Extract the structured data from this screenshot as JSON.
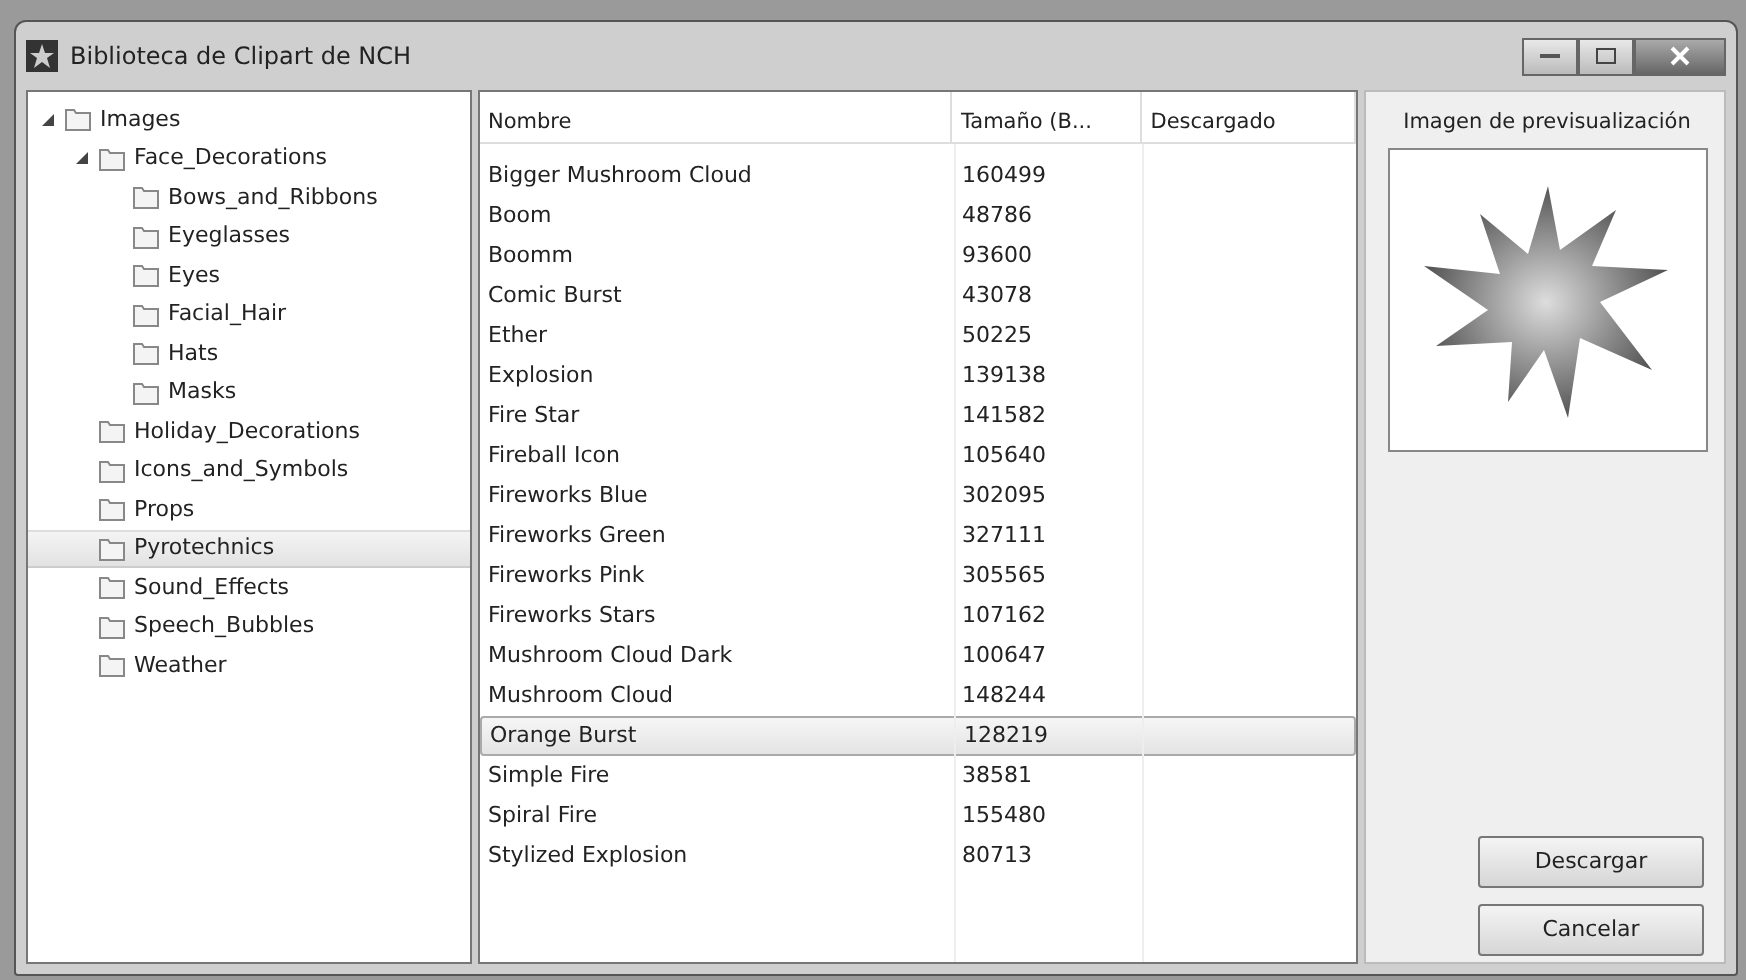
{
  "window": {
    "title": "Biblioteca de Clipart de NCH"
  },
  "tree": [
    {
      "label": "Images",
      "expanded": true,
      "selected": false,
      "children": [
        {
          "label": "Face_Decorations",
          "expanded": true,
          "selected": false,
          "children": [
            {
              "label": "Bows_and_Ribbons",
              "selected": false
            },
            {
              "label": "Eyeglasses",
              "selected": false
            },
            {
              "label": "Eyes",
              "selected": false
            },
            {
              "label": "Facial_Hair",
              "selected": false
            },
            {
              "label": "Hats",
              "selected": false
            },
            {
              "label": "Masks",
              "selected": false
            }
          ]
        },
        {
          "label": "Holiday_Decorations",
          "selected": false
        },
        {
          "label": "Icons_and_Symbols",
          "selected": false
        },
        {
          "label": "Props",
          "selected": false
        },
        {
          "label": "Pyrotechnics",
          "selected": true
        },
        {
          "label": "Sound_Effects",
          "selected": false
        },
        {
          "label": "Speech_Bubbles",
          "selected": false
        },
        {
          "label": "Weather",
          "selected": false
        }
      ]
    }
  ],
  "table": {
    "columns": [
      "Nombre",
      "Tamaño (B...",
      "Descargado"
    ],
    "rows": [
      {
        "name": "Bigger Mushroom Cloud",
        "size": "160499",
        "selected": false
      },
      {
        "name": "Boom",
        "size": "48786",
        "selected": false
      },
      {
        "name": "Boomm",
        "size": "93600",
        "selected": false
      },
      {
        "name": "Comic Burst",
        "size": "43078",
        "selected": false
      },
      {
        "name": "Ether",
        "size": "50225",
        "selected": false
      },
      {
        "name": "Explosion",
        "size": "139138",
        "selected": false
      },
      {
        "name": "Fire Star",
        "size": "141582",
        "selected": false
      },
      {
        "name": "Fireball Icon",
        "size": "105640",
        "selected": false
      },
      {
        "name": "Fireworks Blue",
        "size": "302095",
        "selected": false
      },
      {
        "name": "Fireworks Green",
        "size": "327111",
        "selected": false
      },
      {
        "name": "Fireworks Pink",
        "size": "305565",
        "selected": false
      },
      {
        "name": "Fireworks Stars",
        "size": "107162",
        "selected": false
      },
      {
        "name": "Mushroom Cloud Dark",
        "size": "100647",
        "selected": false
      },
      {
        "name": "Mushroom Cloud",
        "size": "148244",
        "selected": false
      },
      {
        "name": "Orange Burst",
        "size": "128219",
        "selected": true
      },
      {
        "name": "Simple Fire",
        "size": "38581",
        "selected": false
      },
      {
        "name": "Spiral Fire",
        "size": "155480",
        "selected": false
      },
      {
        "name": "Stylized Explosion",
        "size": "80713",
        "selected": false
      }
    ]
  },
  "preview": {
    "label": "Imagen de previsualización"
  },
  "buttons": [
    "Descargar",
    "Cancelar"
  ]
}
